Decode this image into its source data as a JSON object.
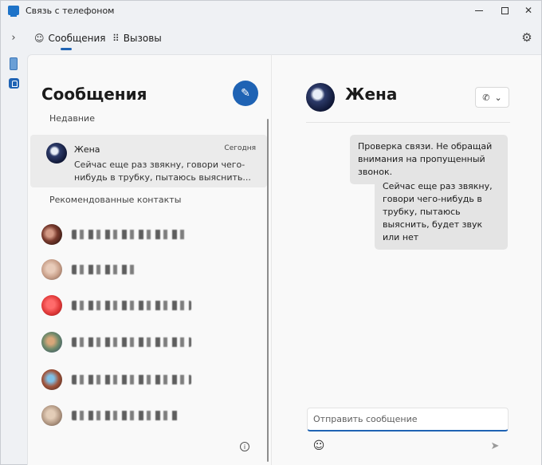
{
  "window": {
    "title": "Связь с телефоном",
    "icons": {
      "app": "phone-link-icon",
      "minimize": "minimize-icon",
      "maximize": "maximize-icon",
      "close": "close-icon"
    }
  },
  "rail": {
    "toggle_icon": "chevron-right-icon",
    "items": [
      {
        "icon": "phone-icon"
      },
      {
        "icon": "notification-icon"
      }
    ]
  },
  "tabs": [
    {
      "label": "Сообщения",
      "icon": "chat-icon",
      "active": true
    },
    {
      "label": "Вызовы",
      "icon": "dialpad-icon",
      "active": false
    }
  ],
  "settings_icon": "gear-icon",
  "list": {
    "title": "Сообщения",
    "compose_icon": "compose-icon",
    "recent_label": "Недавние",
    "conversations": [
      {
        "name": "Жена",
        "time": "Сегодня",
        "preview": "Сейчас еще раз звякну, говори чего-нибудь в трубку, пытаюсь выяснить..."
      }
    ],
    "recommended_label": "Рекомендованные контакты",
    "recommended_contacts": [
      {
        "avatar_color": "#7a3b2e"
      },
      {
        "avatar_color": "#c9a08a"
      },
      {
        "avatar_color": "#e23b3b"
      },
      {
        "avatar_color": "#6f8a6a"
      },
      {
        "avatar_color": "#a0553d"
      },
      {
        "avatar_color": "#b59b86"
      }
    ],
    "info_icon": "info-icon"
  },
  "chat": {
    "contact_name": "Жена",
    "call_icon": "phone-call-icon",
    "messages": [
      "Проверка связи. Не обращай внимания на пропущенный звонок.",
      "Сейчас еще раз звякну, говори чего-нибудь в трубку, пытаюсь выяснить, будет звук или нет"
    ],
    "input_placeholder": "Отправить сообщение",
    "emoji_icon": "emoji-icon",
    "send_icon": "send-icon"
  },
  "colors": {
    "accent": "#1f63b4",
    "bubble": "#e4e4e4",
    "panel": "#f9f9f9"
  }
}
